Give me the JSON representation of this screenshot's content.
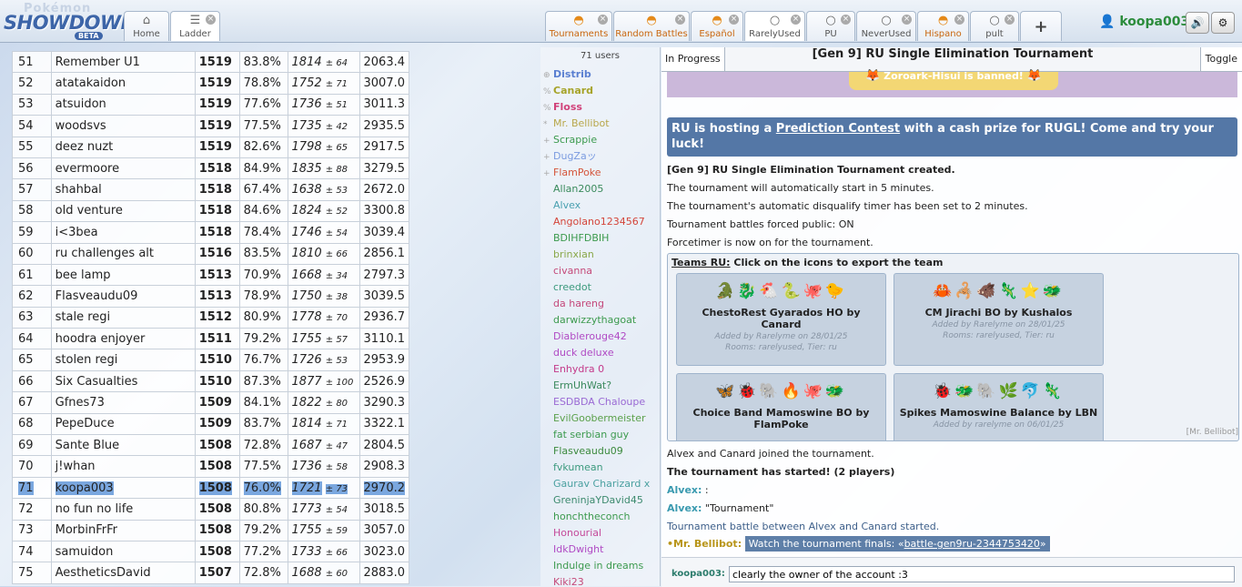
{
  "logo": {
    "top": "Pokémon",
    "main": "SHOWDOWN!",
    "badge": "BETA"
  },
  "nav_tabs": [
    {
      "label": "Home",
      "icon": "home-icon"
    },
    {
      "label": "Ladder",
      "icon": "list-icon"
    }
  ],
  "room_tabs": [
    {
      "label": "Tournaments"
    },
    {
      "label": "Random Battles"
    },
    {
      "label": "Español"
    },
    {
      "label": "RarelyUsed"
    },
    {
      "label": "PU"
    },
    {
      "label": "NeverUsed"
    },
    {
      "label": "Hispano"
    },
    {
      "label": "pult"
    }
  ],
  "plus_label": "+",
  "user": {
    "name": "koopa003"
  },
  "ladder_rows": [
    [
      "51",
      "Remember U1",
      "1519",
      "83.8%",
      "1814",
      "± 64",
      "2063.4"
    ],
    [
      "52",
      "atatakaidon",
      "1519",
      "78.8%",
      "1752",
      "± 71",
      "3007.0"
    ],
    [
      "53",
      "atsuidon",
      "1519",
      "77.6%",
      "1736",
      "± 51",
      "3011.3"
    ],
    [
      "54",
      "woodsvs",
      "1519",
      "77.5%",
      "1735",
      "± 42",
      "2935.5"
    ],
    [
      "55",
      "deez nuzt",
      "1519",
      "82.6%",
      "1798",
      "± 65",
      "2917.5"
    ],
    [
      "56",
      "evermoore",
      "1518",
      "84.9%",
      "1835",
      "± 88",
      "3279.5"
    ],
    [
      "57",
      "shahbal",
      "1518",
      "67.4%",
      "1638",
      "± 53",
      "2672.0"
    ],
    [
      "58",
      "old venture",
      "1518",
      "84.6%",
      "1824",
      "± 52",
      "3300.8"
    ],
    [
      "59",
      "i<3bea",
      "1518",
      "78.4%",
      "1746",
      "± 54",
      "3039.4"
    ],
    [
      "60",
      "ru challenges alt",
      "1516",
      "83.5%",
      "1810",
      "± 66",
      "2856.1"
    ],
    [
      "61",
      "bee lamp",
      "1513",
      "70.9%",
      "1668",
      "± 34",
      "2797.3"
    ],
    [
      "62",
      "Flasveaudu09",
      "1513",
      "78.9%",
      "1750",
      "± 38",
      "3039.5"
    ],
    [
      "63",
      "stale regi",
      "1512",
      "80.9%",
      "1778",
      "± 70",
      "2936.7"
    ],
    [
      "64",
      "hoodra enjoyer",
      "1511",
      "79.2%",
      "1755",
      "± 57",
      "3110.1"
    ],
    [
      "65",
      "stolen regi",
      "1510",
      "76.7%",
      "1726",
      "± 53",
      "2953.9"
    ],
    [
      "66",
      "Six Casualties",
      "1510",
      "87.3%",
      "1877",
      "± 100",
      "2526.9"
    ],
    [
      "67",
      "Gfnes73",
      "1509",
      "84.1%",
      "1822",
      "± 80",
      "3290.3"
    ],
    [
      "68",
      "PepeDuce",
      "1509",
      "83.7%",
      "1814",
      "± 71",
      "3322.1"
    ],
    [
      "69",
      "Sante Blue",
      "1508",
      "72.8%",
      "1687",
      "± 47",
      "2804.5"
    ],
    [
      "70",
      "j!whan",
      "1508",
      "77.5%",
      "1736",
      "± 58",
      "2908.3"
    ],
    [
      "71",
      "koopa003",
      "1508",
      "76.0%",
      "1721",
      "± 73",
      "2970.2"
    ],
    [
      "72",
      "no fun no life",
      "1508",
      "80.8%",
      "1773",
      "± 54",
      "3018.5"
    ],
    [
      "73",
      "MorbinFrFr",
      "1508",
      "79.2%",
      "1755",
      "± 59",
      "3057.0"
    ],
    [
      "74",
      "samuidon",
      "1508",
      "77.2%",
      "1733",
      "± 66",
      "3023.0"
    ],
    [
      "75",
      "AestheticsDavid",
      "1507",
      "72.8%",
      "1688",
      "± 60",
      "2883.0"
    ]
  ],
  "highlight_rank": "71",
  "userlist": {
    "count": "71 users",
    "users": [
      {
        "sym": "⊕",
        "name": "Distrib",
        "color": "#5a7fd1",
        "bold": true
      },
      {
        "sym": "%",
        "name": "Canard",
        "color": "#a6a329",
        "bold": true
      },
      {
        "sym": "%",
        "name": "Floss",
        "color": "#d1427a",
        "bold": true
      },
      {
        "sym": "*",
        "name": "Mr. Bellibot",
        "color": "#b8a74a",
        "bold": false
      },
      {
        "sym": "+",
        "name": "Scrappie",
        "color": "#3c9a4e",
        "bold": false
      },
      {
        "sym": "+",
        "name": "DugZaッ",
        "color": "#7a9be0",
        "bold": false
      },
      {
        "sym": "+",
        "name": "FlamPoke",
        "color": "#d4553a",
        "bold": false
      },
      {
        "sym": "",
        "name": "Allan2005",
        "color": "#3a8a5c",
        "bold": false
      },
      {
        "sym": "",
        "name": "Alvex",
        "color": "#4aa0b0",
        "bold": false
      },
      {
        "sym": "",
        "name": "Angolano1234567",
        "color": "#d4453a",
        "bold": false
      },
      {
        "sym": "",
        "name": "BDIHFDBIH",
        "color": "#3c9a4e",
        "bold": false
      },
      {
        "sym": "",
        "name": "brinxian",
        "color": "#8aa84a",
        "bold": false
      },
      {
        "sym": "",
        "name": "civanna",
        "color": "#c44a7a",
        "bold": false
      },
      {
        "sym": "",
        "name": "creedot",
        "color": "#3c9a7e",
        "bold": false
      },
      {
        "sym": "",
        "name": "da hareng",
        "color": "#c4487a",
        "bold": false
      },
      {
        "sym": "",
        "name": "darwizzythagoat",
        "color": "#3c9a4e",
        "bold": false
      },
      {
        "sym": "",
        "name": "Diablerouge42",
        "color": "#b04ac4",
        "bold": false
      },
      {
        "sym": "",
        "name": "duck deluxe",
        "color": "#b04ac4",
        "bold": false
      },
      {
        "sym": "",
        "name": "Enhydra 0",
        "color": "#c43a8a",
        "bold": false
      },
      {
        "sym": "",
        "name": "ErmUhWat?",
        "color": "#3c8a5e",
        "bold": false
      },
      {
        "sym": "",
        "name": "ESDBDA Chaloupe",
        "color": "#9a6ad4",
        "bold": false
      },
      {
        "sym": "",
        "name": "EvilGoobermeister",
        "color": "#5aa04a",
        "bold": false
      },
      {
        "sym": "",
        "name": "fat serbian guy",
        "color": "#3c9a4e",
        "bold": false
      },
      {
        "sym": "",
        "name": "Flasveaudu09",
        "color": "#3c8a3e",
        "bold": false
      },
      {
        "sym": "",
        "name": "fvkumean",
        "color": "#3c9a7e",
        "bold": false
      },
      {
        "sym": "",
        "name": "Gaurav Charizard x",
        "color": "#4aa0a0",
        "bold": false
      },
      {
        "sym": "",
        "name": "GreninjaYDavid45",
        "color": "#3c8a6e",
        "bold": false
      },
      {
        "sym": "",
        "name": "honchtheconch",
        "color": "#3c9a4e",
        "bold": false
      },
      {
        "sym": "",
        "name": "Honourial",
        "color": "#c44a9a",
        "bold": false
      },
      {
        "sym": "",
        "name": "IdkDwight",
        "color": "#b04ac4",
        "bold": false
      },
      {
        "sym": "",
        "name": "Indulge in dreams",
        "color": "#3c9a4e",
        "bold": false
      },
      {
        "sym": "",
        "name": "Kiki23",
        "color": "#c44a7a",
        "bold": false
      }
    ]
  },
  "chat": {
    "in_progress": "In Progress",
    "title": "[Gen 9] RU Single Elimination Tournament",
    "toggle": "Toggle",
    "banned_text": "Zoroark-Hisui is banned!",
    "promo_pre": "RU is hosting a ",
    "promo_link": "Prediction Contest",
    "promo_post": " with a cash prize for RUGL! Come and try your luck!",
    "created": "[Gen 9] RU Single Elimination Tournament created.",
    "auto_start": "The tournament will automatically start in 5 minutes.",
    "dq_timer": "The tournament's automatic disqualify timer has been set to 2 minutes.",
    "forced_public": "Tournament battles forced public: ON",
    "forcetimer": "Forcetimer is now on for the tournament.",
    "teams_header_link": "Teams RU:",
    "teams_header_rest": " Click on the icons to export the team",
    "teams": [
      {
        "name": "ChestoRest Gyarados HO by Canard",
        "added": "Added by Rarelyme on 28/01/25",
        "rooms": "Rooms: rarelyused, Tier: ru",
        "sprites": "🐊🐉🐔🐍🐙🐤"
      },
      {
        "name": "CM Jirachi BO by Kushalos",
        "added": "Added by Rarelyme on 28/01/25",
        "rooms": "Rooms: rarelyused, Tier: ru",
        "sprites": "🦀🦂🐗🦎⭐🐲"
      },
      {
        "name": "Choice Band Mamoswine BO by FlamPoke",
        "added": "",
        "rooms": "",
        "sprites": "🦋🐞🐘🔥🐙🐲"
      },
      {
        "name": "Spikes Mamoswine Balance by LBN",
        "added": "Added by rarelyme on 06/01/25",
        "rooms": "",
        "sprites": "🐞🐲🐘🌿🐬🦎"
      }
    ],
    "bellibot_tag": "[Mr. Bellibot]",
    "joined": "Alvex and Canard joined the tournament.",
    "started": "The tournament has started! (2 players)",
    "alvex1_name": "Alvex:",
    "alvex1_text": " :",
    "alvex2_name": "Alvex:",
    "alvex2_text": " \"Tournament\"",
    "battle_started": "Tournament battle between Alvex and Canard started.",
    "bellibot_name": "•Mr. Bellibot:",
    "bellibot_pre": "Watch the tournament finals: «",
    "bellibot_link": "battle-gen9ru-2344753420",
    "bellibot_post": "»",
    "input_name": "koopa003:",
    "input_value": "clearly the owner of the account :3"
  }
}
